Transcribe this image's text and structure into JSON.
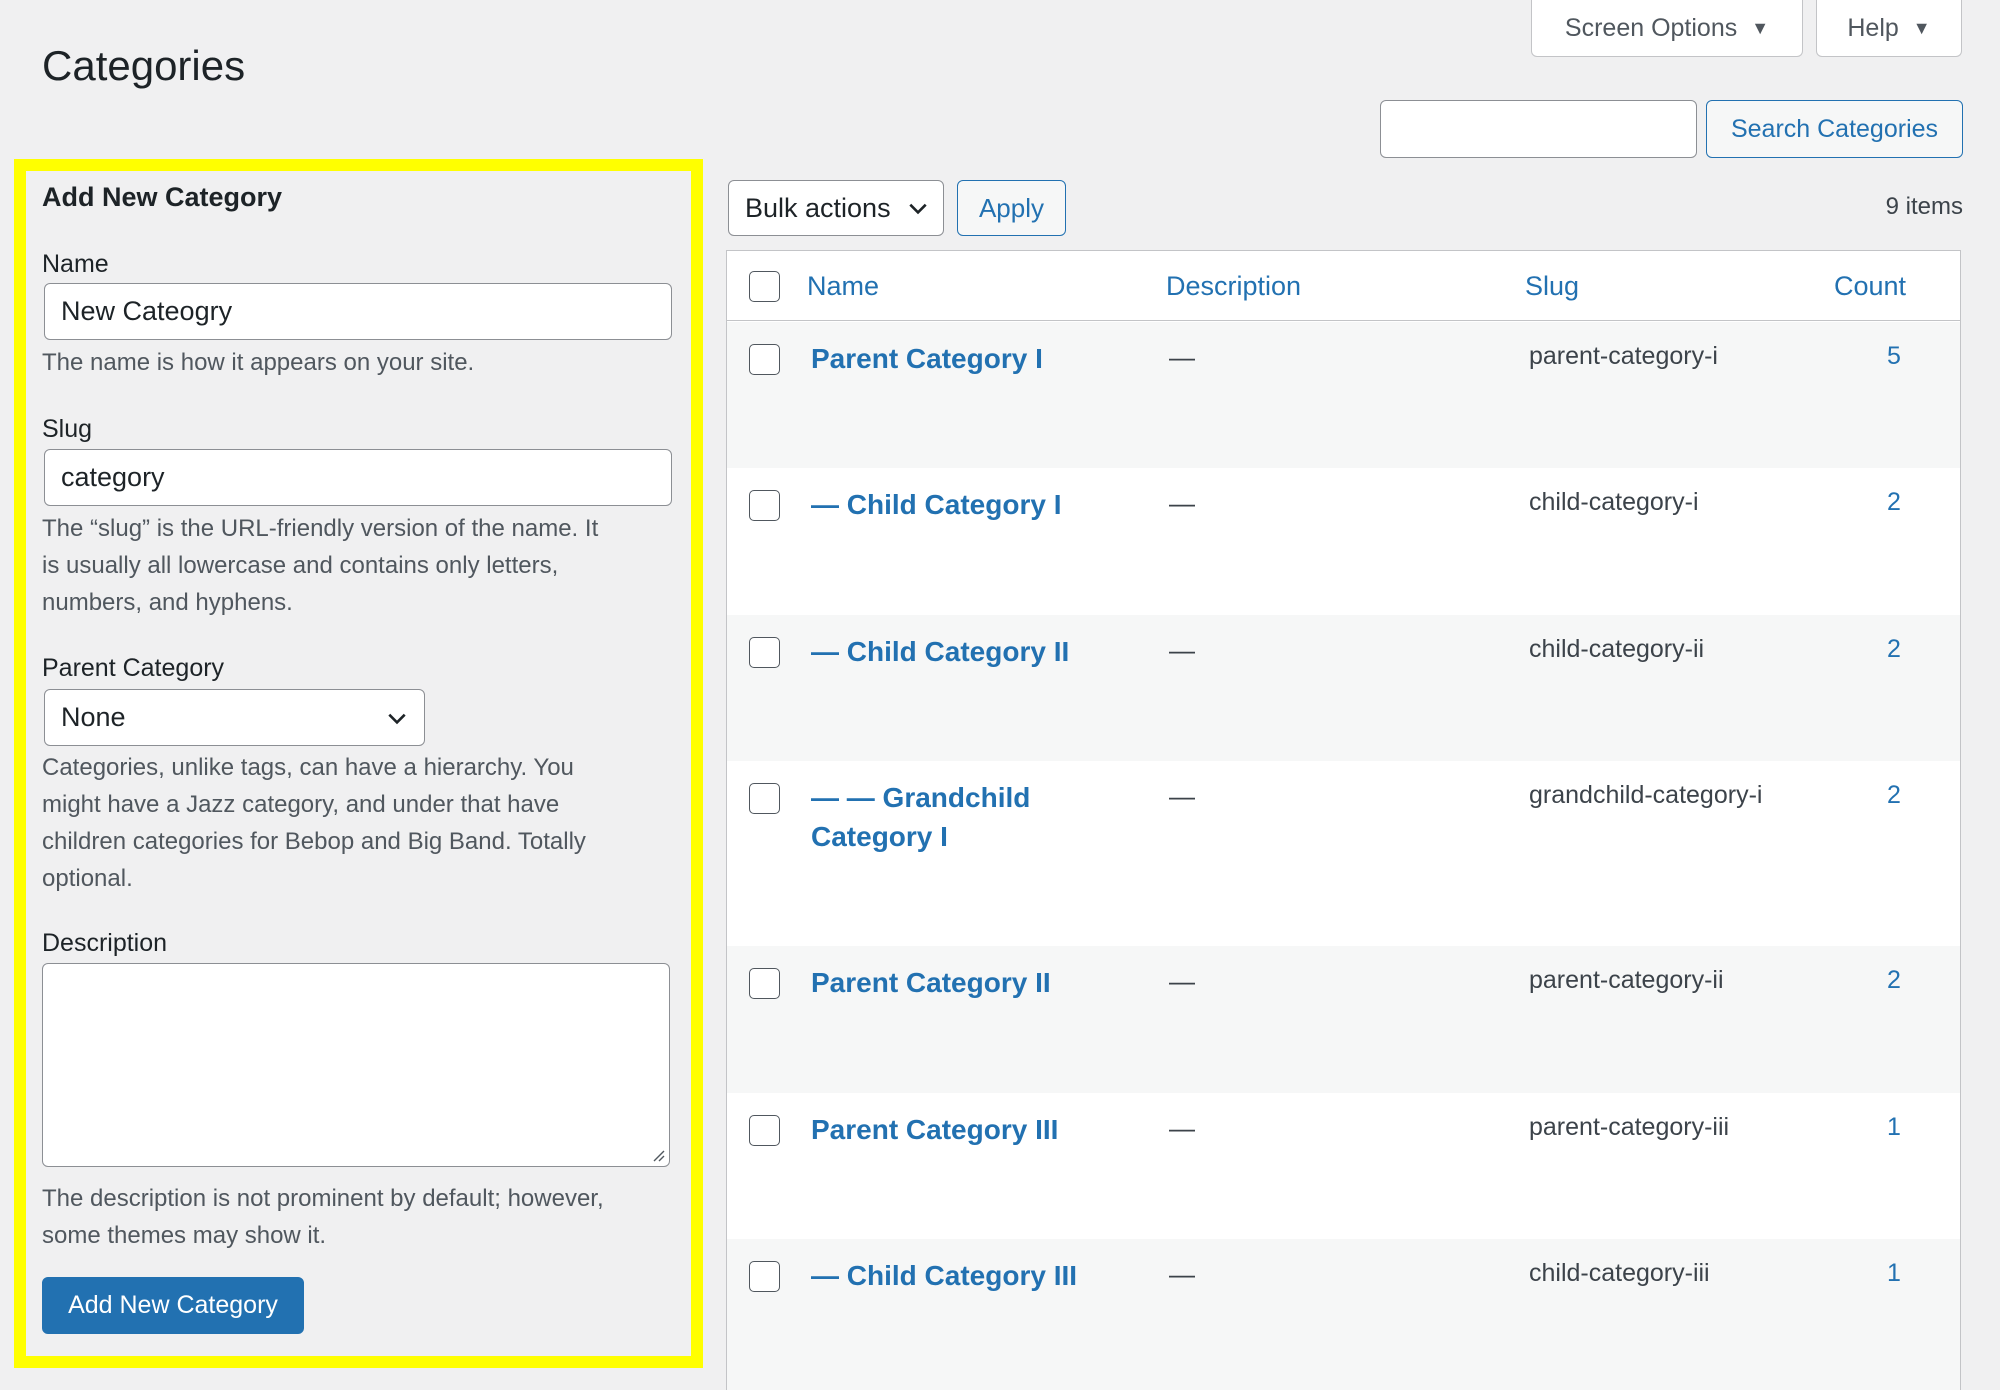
{
  "header": {
    "screen_options": "Screen Options",
    "help": "Help",
    "page_title": "Categories"
  },
  "search": {
    "input_value": "",
    "button_label": "Search Categories"
  },
  "form": {
    "title": "Add New Category",
    "name_label": "Name",
    "name_value": "New Cateogry",
    "name_help": "The name is how it appears on your site.",
    "slug_label": "Slug",
    "slug_value": "category",
    "slug_help_lines": [
      "The “slug” is the URL-friendly version of the name. It",
      "is usually all lowercase and contains only letters,",
      "numbers, and hyphens."
    ],
    "parent_label": "Parent Category",
    "parent_value": "None",
    "parent_help_lines": [
      "Categories, unlike tags, can have a hierarchy. You",
      "might have a Jazz category, and under that have",
      "children categories for Bebop and Big Band. Totally",
      "optional."
    ],
    "description_label": "Description",
    "description_value": "",
    "description_help_lines": [
      "The description is not prominent by default; however,",
      "some themes may show it."
    ],
    "submit_label": "Add New Category"
  },
  "list": {
    "bulk_actions": "Bulk actions",
    "apply": "Apply",
    "items_count": "9 items",
    "columns": {
      "name": "Name",
      "description": "Description",
      "slug": "Slug",
      "count": "Count"
    },
    "rows": [
      {
        "name_lines": [
          "Parent Category I"
        ],
        "description": "—",
        "slug": "parent-category-i",
        "count": "5"
      },
      {
        "name_lines": [
          "— Child Category I"
        ],
        "description": "—",
        "slug": "child-category-i",
        "count": "2"
      },
      {
        "name_lines": [
          "— Child Category II"
        ],
        "description": "—",
        "slug": "child-category-ii",
        "count": "2"
      },
      {
        "name_lines": [
          "— — Grandchild",
          "Category I"
        ],
        "description": "—",
        "slug": "grandchild-category-i",
        "count": "2"
      },
      {
        "name_lines": [
          "Parent Category II"
        ],
        "description": "—",
        "slug": "parent-category-ii",
        "count": "2"
      },
      {
        "name_lines": [
          "Parent Category III"
        ],
        "description": "—",
        "slug": "parent-category-iii",
        "count": "1"
      },
      {
        "name_lines": [
          "— Child Category III"
        ],
        "description": "—",
        "slug": "child-category-iii",
        "count": "1"
      }
    ]
  },
  "colors": {
    "accent": "#2271b1",
    "highlight": "#ffff00",
    "background": "#f0f0f1"
  }
}
